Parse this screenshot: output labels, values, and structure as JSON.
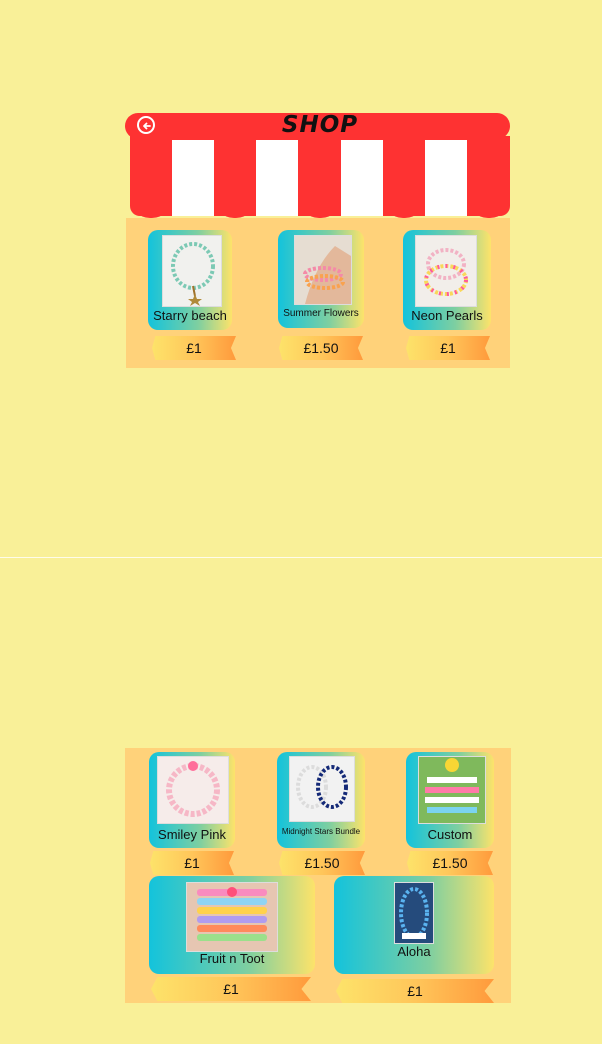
{
  "shop": {
    "title": "SHOP"
  },
  "products_top": [
    {
      "name": "Starry beach",
      "price": "£1"
    },
    {
      "name": "Summer Flowers",
      "price": "£1.50"
    },
    {
      "name": "Neon Pearls",
      "price": "£1"
    }
  ],
  "products_bottom": [
    {
      "name": "Smiley Pink",
      "price": "£1"
    },
    {
      "name": "Midnight Stars Bundle",
      "price": "£1.50"
    },
    {
      "name": "Custom",
      "price": "£1.50"
    },
    {
      "name": "Fruit n Toot",
      "price": "£1"
    },
    {
      "name": "Aloha",
      "price": "£1"
    }
  ],
  "colors": {
    "background": "#f9f098",
    "awning_red": "#fe3232",
    "panel": "#ffd27a",
    "card_gradient_start": "#13c3dc",
    "card_gradient_end": "#fde36a",
    "price_tag_end": "#ff9a3c"
  },
  "icons": {
    "back": "circle-left-arrow-icon"
  }
}
